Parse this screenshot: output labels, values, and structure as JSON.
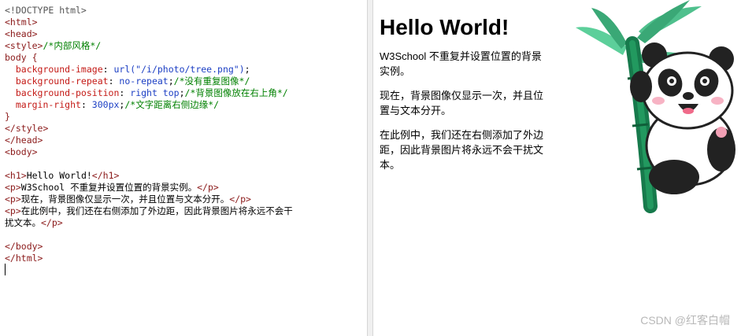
{
  "editor": {
    "lines": [
      [
        {
          "t": "<!DOCTYPE html>",
          "c": "t-doc"
        }
      ],
      [
        {
          "t": "<html>",
          "c": "t-tag"
        }
      ],
      [
        {
          "t": "<head>",
          "c": "t-tag"
        }
      ],
      [
        {
          "t": "<style>",
          "c": "t-tag"
        },
        {
          "t": "/*内部风格*/",
          "c": "t-cm"
        }
      ],
      [
        {
          "t": "body {",
          "c": "t-tag"
        }
      ],
      [
        {
          "t": "  background-image",
          "c": "t-prop"
        },
        {
          "t": ": ",
          "c": "t-plain"
        },
        {
          "t": "url(\"/i/photo/tree.png\")",
          "c": "t-val"
        },
        {
          "t": ";",
          "c": "t-plain"
        }
      ],
      [
        {
          "t": "  background-repeat",
          "c": "t-prop"
        },
        {
          "t": ": ",
          "c": "t-plain"
        },
        {
          "t": "no-repeat",
          "c": "t-val"
        },
        {
          "t": ";",
          "c": "t-plain"
        },
        {
          "t": "/*没有重复图像*/",
          "c": "t-cm"
        }
      ],
      [
        {
          "t": "  background-position",
          "c": "t-prop"
        },
        {
          "t": ": ",
          "c": "t-plain"
        },
        {
          "t": "right top",
          "c": "t-val"
        },
        {
          "t": ";",
          "c": "t-plain"
        },
        {
          "t": "/*背景图像放在右上角*/",
          "c": "t-cm"
        }
      ],
      [
        {
          "t": "  margin-right",
          "c": "t-prop"
        },
        {
          "t": ": ",
          "c": "t-plain"
        },
        {
          "t": "300px",
          "c": "t-val"
        },
        {
          "t": ";",
          "c": "t-plain"
        },
        {
          "t": "/*文字距离右侧边缘*/",
          "c": "t-cm"
        }
      ],
      [
        {
          "t": "}",
          "c": "t-tag"
        }
      ],
      [
        {
          "t": "</style>",
          "c": "t-tag"
        }
      ],
      [
        {
          "t": "</head>",
          "c": "t-tag"
        }
      ],
      [
        {
          "t": "<body>",
          "c": "t-tag"
        }
      ],
      [
        {
          "t": "",
          "c": "t-plain"
        }
      ],
      [
        {
          "t": "<h1>",
          "c": "t-tag"
        },
        {
          "t": "Hello World!",
          "c": "t-plain"
        },
        {
          "t": "</h1>",
          "c": "t-tag"
        }
      ],
      [
        {
          "t": "<p>",
          "c": "t-tag"
        },
        {
          "t": "W3School 不重复并设置位置的背景实例。",
          "c": "t-plain"
        },
        {
          "t": "</p>",
          "c": "t-tag"
        }
      ],
      [
        {
          "t": "<p>",
          "c": "t-tag"
        },
        {
          "t": "现在，背景图像仅显示一次，并且位置与文本分开。",
          "c": "t-plain"
        },
        {
          "t": "</p>",
          "c": "t-tag"
        }
      ],
      [
        {
          "t": "<p>",
          "c": "t-tag"
        },
        {
          "t": "在此例中，我们还在右侧添加了外边距，因此背景图片将永远不会干",
          "c": "t-plain"
        }
      ],
      [
        {
          "t": "扰文本。",
          "c": "t-plain"
        },
        {
          "t": "</p>",
          "c": "t-tag"
        }
      ],
      [
        {
          "t": "",
          "c": "t-plain"
        }
      ],
      [
        {
          "t": "</body>",
          "c": "t-tag"
        }
      ],
      [
        {
          "t": "</html>",
          "c": "t-tag"
        }
      ]
    ]
  },
  "preview": {
    "heading": "Hello World!",
    "paragraphs": [
      "W3School 不重复并设置位置的背景实例。",
      "现在，背景图像仅显示一次，并且位置与文本分开。",
      "在此例中，我们还在右侧添加了外边距，因此背景图片将永远不会干扰文本。"
    ],
    "image_icon": "panda-on-bamboo-illustration"
  },
  "watermark": "CSDN @红客白帽",
  "colors": {
    "tag": "#8b1a1a",
    "comment": "#008000",
    "property": "#c41a16",
    "value": "#1c3fc4",
    "bamboo": "#1e8a5a",
    "leaf": "#4fc08d"
  }
}
